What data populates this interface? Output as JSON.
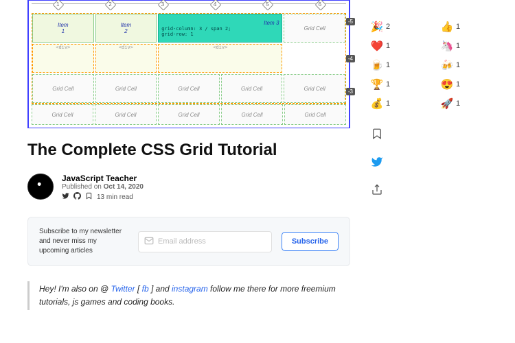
{
  "hero": {
    "cols": [
      "1",
      "2",
      "3",
      "4",
      "5",
      "6"
    ],
    "item1": "Item",
    "item1n": "1",
    "item2": "Item",
    "item2n": "2",
    "item3": "Item 3",
    "item3code1": "grid-column: 3 / span 2;",
    "item3code2": "grid-row: 1",
    "div": "<div>",
    "gc": "Grid Cell",
    "r5": "-5",
    "r4": "-4",
    "r3": "-3"
  },
  "title": "The Complete CSS Grid Tutorial",
  "author": {
    "name": "JavaScript Teacher",
    "pub_prefix": "Published on ",
    "pub_date": "Oct 14, 2020",
    "read": "13 min read"
  },
  "subscribe": {
    "txt": "Subscribe to my newsletter and never miss my upcoming articles",
    "placeholder": "Email address",
    "btn": "Subscribe"
  },
  "intro": {
    "t1": "Hey! I'm also on @ ",
    "twitter": "Twitter",
    "t2": " [ ",
    "fb": "fb",
    "t3": " ] and ",
    "ig": "instagram",
    "t4": " follow me there for more freemium tutorials, js games and coding books."
  },
  "reactions": [
    {
      "icon": "🎉",
      "count": "2"
    },
    {
      "icon": "👍",
      "count": "1"
    },
    {
      "icon": "❤️",
      "count": "1"
    },
    {
      "icon": "🦄",
      "count": "1"
    },
    {
      "icon": "🍺",
      "count": "1"
    },
    {
      "icon": "🍻",
      "count": "1"
    },
    {
      "icon": "🏆",
      "count": "1"
    },
    {
      "icon": "😍",
      "count": "1"
    },
    {
      "icon": "💰",
      "count": "1"
    },
    {
      "icon": "🚀",
      "count": "1"
    }
  ]
}
